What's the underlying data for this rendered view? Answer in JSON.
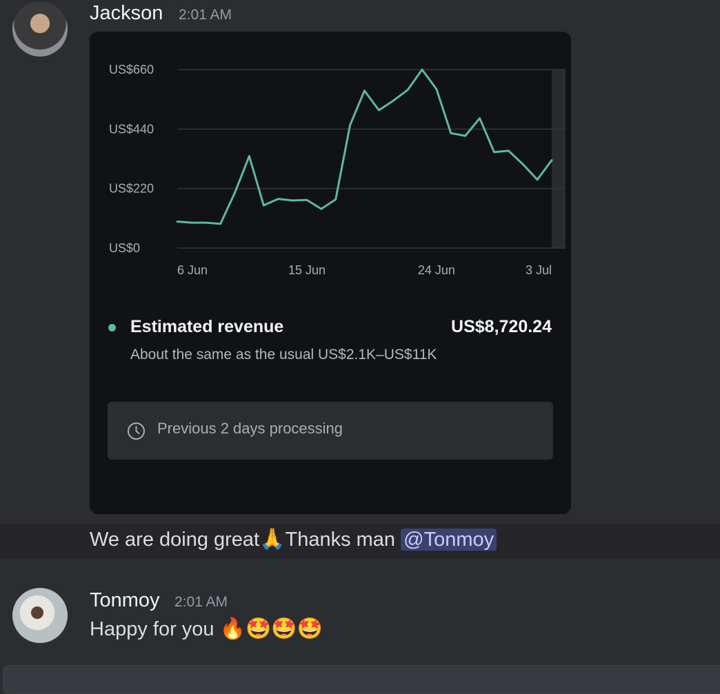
{
  "messages": [
    {
      "author": "Jackson",
      "time": "2:01 AM",
      "text_before_emoji": "We are doing great",
      "emoji": "🙏",
      "text_after_emoji": "Thanks man ",
      "mention": "@Tonmoy"
    },
    {
      "author": "Tonmoy",
      "time": "2:01 AM",
      "text": "Happy for you ",
      "emojis": "🔥🤩🤩🤩"
    }
  ],
  "card": {
    "metric_label": "Estimated revenue",
    "metric_value": "US$8,720.24",
    "metric_note": "About the same as the usual US$2.1K–US$11K",
    "processing_text": "Previous 2 days processing",
    "accent_color": "#5db8a4"
  },
  "chart_data": {
    "type": "line",
    "y_tick_labels": [
      "US$660",
      "US$440",
      "US$220",
      "US$0"
    ],
    "y_ticks": [
      660,
      440,
      220,
      0
    ],
    "ylim": [
      0,
      660
    ],
    "x_tick_labels": [
      "6 Jun",
      "15 Jun",
      "24 Jun",
      "3 Jul"
    ],
    "x_tick_index": [
      0,
      9,
      18,
      26
    ],
    "series": [
      {
        "values": [
          98,
          94,
          94,
          90,
          205,
          340,
          158,
          182,
          176,
          178,
          145,
          180,
          455,
          582,
          510,
          545,
          585,
          660,
          588,
          425,
          415,
          480,
          355,
          360,
          310,
          253,
          325
        ]
      }
    ],
    "grid": true,
    "line_color": "#5db8a4"
  }
}
